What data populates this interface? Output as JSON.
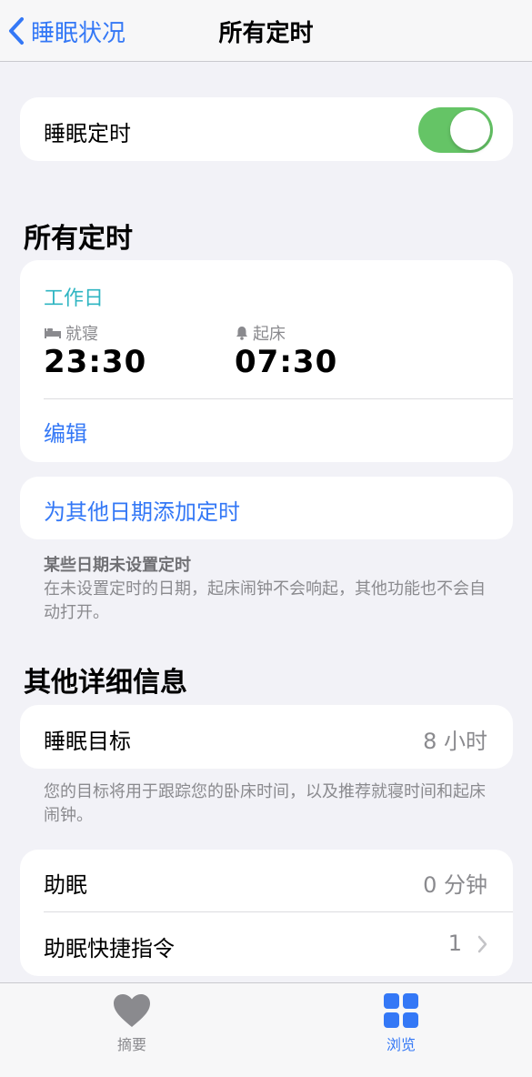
{
  "nav": {
    "back_label": "睡眠状况",
    "title": "所有定时"
  },
  "sleep_schedule": {
    "label": "睡眠定时",
    "enabled": true
  },
  "all_schedules": {
    "section_title": "所有定时",
    "schedule": {
      "days": "工作日",
      "bedtime_label": "就寝",
      "bedtime": "23:30",
      "wake_label": "起床",
      "wake_time": "07:30",
      "edit_label": "编辑"
    },
    "add_label": "为其他日期添加定时",
    "note_title": "某些日期未设置定时",
    "note_body": "在未设置定时的日期，起床闹钟不会响起，其他功能也不会自动打开。"
  },
  "details": {
    "section_title": "其他详细信息",
    "sleep_goal_label": "睡眠目标",
    "sleep_goal_value": "8 小时",
    "sleep_goal_note": "您的目标将用于跟踪您的卧床时间，以及推荐就寝时间和起床闹钟。",
    "wind_down_label": "助眠",
    "wind_down_value": "0 分钟",
    "shortcuts_label": "助眠快捷指令",
    "shortcuts_value": "1"
  },
  "tabbar": {
    "summary_label": "摘要",
    "browse_label": "浏览",
    "active_color": "#3478f6",
    "inactive_color": "#8a8a8e"
  }
}
